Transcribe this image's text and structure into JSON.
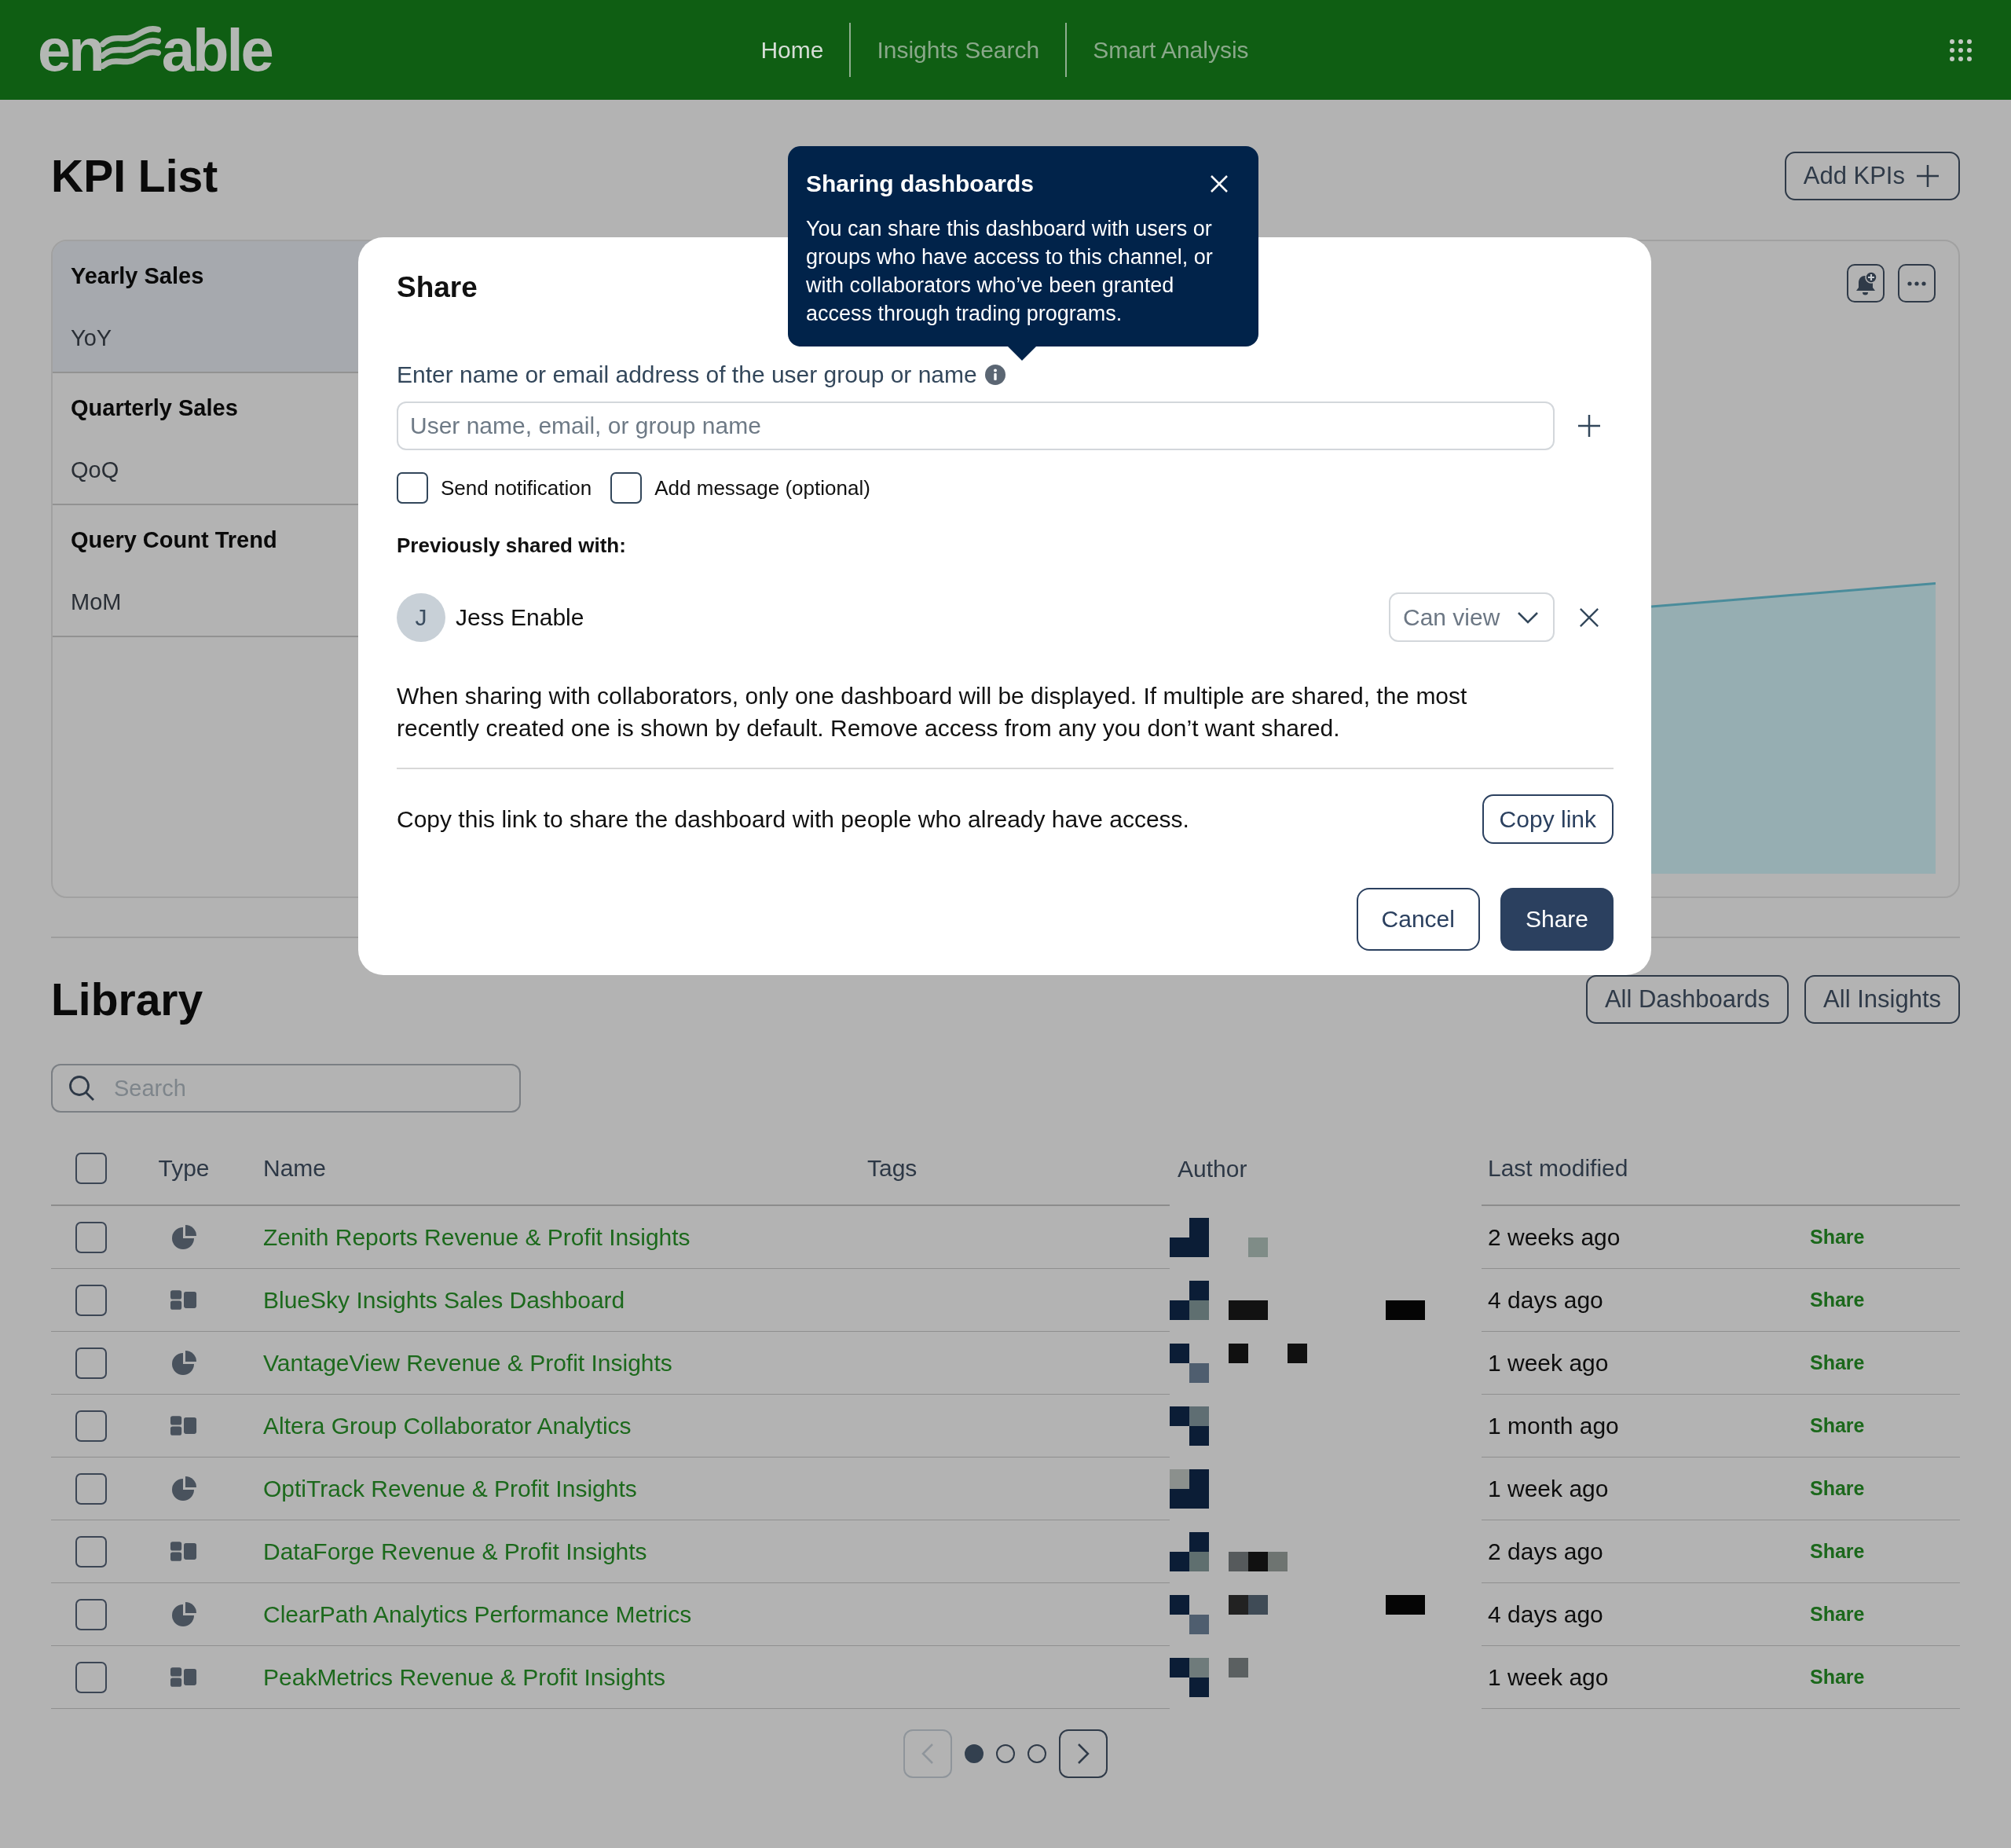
{
  "header": {
    "logo": {
      "parts": [
        "en",
        "able"
      ]
    },
    "nav": [
      {
        "label": "Home",
        "selected": true
      },
      {
        "label": "Insights Search",
        "selected": false
      },
      {
        "label": "Smart Analysis",
        "selected": false
      }
    ]
  },
  "kpi_list": {
    "title": "KPI List",
    "add_button": "Add KPIs",
    "items": [
      {
        "name": "Yearly Sales",
        "period": "YoY",
        "selected": true
      },
      {
        "name": "Quarterly Sales",
        "period": "QoQ",
        "selected": false
      },
      {
        "name": "Query Count Trend",
        "period": "MoM",
        "selected": false
      }
    ]
  },
  "library": {
    "title": "Library",
    "filters": [
      "All Dashboards",
      "All Insights"
    ],
    "search": {
      "placeholder": "Search"
    },
    "table": {
      "select_all_checked": false,
      "columns": [
        "Type",
        "Name",
        "Tags",
        "Author",
        "Last modified"
      ],
      "rows": [
        {
          "checked": false,
          "kind": "insight",
          "name": "Zenith Reports Revenue & Profit Insights",
          "last_modified": "2 weeks ago",
          "action": "Share"
        },
        {
          "checked": false,
          "kind": "dashboard",
          "name": "BlueSky Insights Sales Dashboard",
          "last_modified": "4 days ago",
          "action": "Share"
        },
        {
          "checked": false,
          "kind": "insight",
          "name": "VantageView Revenue & Profit Insights",
          "last_modified": "1 week ago",
          "action": "Share"
        },
        {
          "checked": false,
          "kind": "dashboard",
          "name": "Altera Group Collaborator Analytics",
          "last_modified": "1 month ago",
          "action": "Share"
        },
        {
          "checked": false,
          "kind": "insight",
          "name": "OptiTrack Revenue & Profit Insights",
          "last_modified": "1 week ago",
          "action": "Share"
        },
        {
          "checked": false,
          "kind": "dashboard",
          "name": "DataForge Revenue & Profit Insights",
          "last_modified": "2 days ago",
          "action": "Share"
        },
        {
          "checked": false,
          "kind": "insight",
          "name": "ClearPath Analytics Performance Metrics",
          "last_modified": "4 days ago",
          "action": "Share"
        },
        {
          "checked": false,
          "kind": "dashboard",
          "name": "PeakMetrics Revenue & Profit Insights",
          "last_modified": "1 week ago",
          "action": "Share"
        }
      ]
    },
    "pagination": {
      "prev_disabled": true,
      "next_disabled": false,
      "pages": [
        {
          "selected": true
        },
        {
          "selected": false
        },
        {
          "selected": false
        }
      ]
    }
  },
  "share_dialog": {
    "title": "Share",
    "field_label": "Enter name or email address of the user group or name",
    "input": {
      "placeholder": "User name, email, or group name"
    },
    "options": [
      {
        "label": "Send notification",
        "checked": false
      },
      {
        "label": "Add message (optional)",
        "checked": false
      }
    ],
    "shared_heading": "Previously shared with:",
    "shared_with": [
      {
        "initial": "J",
        "name": "Jess Enable",
        "permission": "Can view"
      }
    ],
    "notice": "When sharing with collaborators, only one dashboard will be displayed. If multiple are shared, the most recently created one is shown by default. Remove access from any you don’t want shared.",
    "copy_text": "Copy this link to share the dashboard with people who already have access.",
    "copy_button": "Copy link",
    "buttons": [
      {
        "label": "Cancel",
        "kind": "secondary"
      },
      {
        "label": "Share",
        "kind": "primary"
      }
    ]
  },
  "tooltip": {
    "title": "Sharing dashboards",
    "body": "You can share this dashboard with users or groups who have access to this channel, or with collaborators who’ve been granted access through trading programs."
  }
}
